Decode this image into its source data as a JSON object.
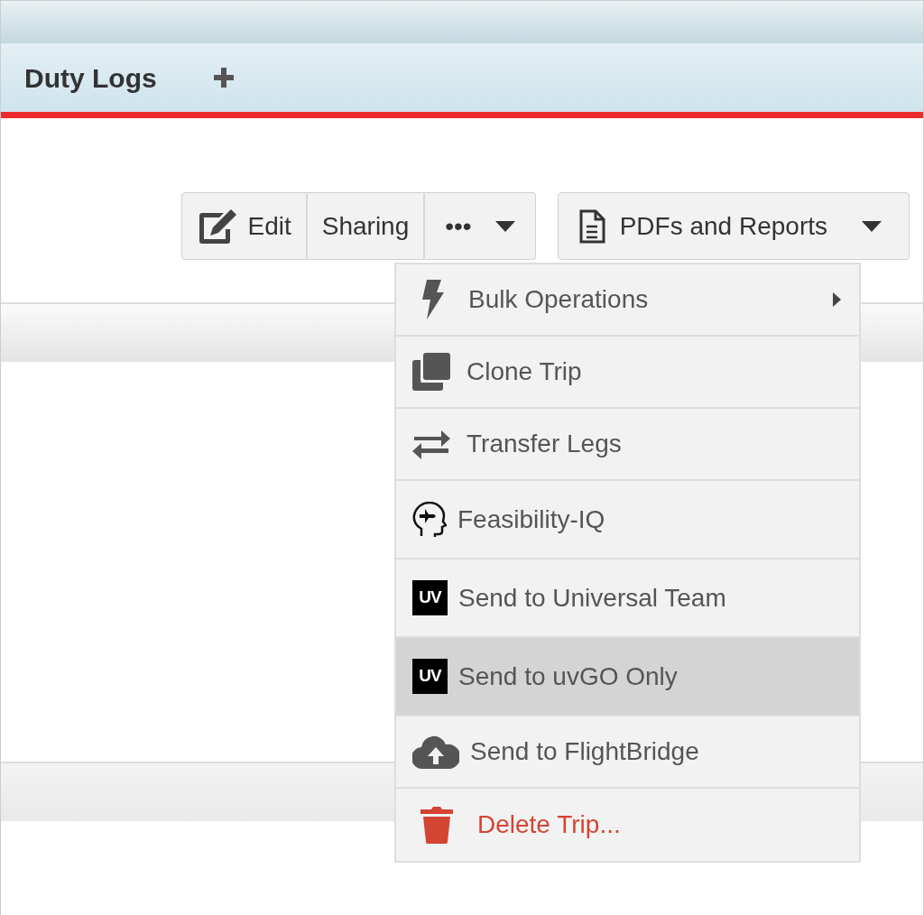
{
  "tab_bar": {
    "title": "Duty Logs"
  },
  "toolbar": {
    "buttons": [
      {
        "kind": "edit",
        "label": "Edit"
      },
      {
        "kind": "plain",
        "label": "Sharing"
      },
      {
        "kind": "more",
        "label": "•••",
        "expanded": true
      }
    ],
    "reports_button": {
      "label": "PDFs and Reports"
    }
  },
  "menu": {
    "items": [
      {
        "kind": "bolt",
        "label": "Bulk Operations",
        "submenu": true,
        "selected": false,
        "danger": false
      },
      {
        "kind": "copy",
        "label": "Clone Trip",
        "submenu": false,
        "selected": false,
        "danger": false
      },
      {
        "kind": "swap",
        "label": "Transfer Legs",
        "submenu": false,
        "selected": false,
        "danger": false
      },
      {
        "kind": "head",
        "label": "Feasibility-IQ",
        "submenu": false,
        "selected": false,
        "danger": false
      },
      {
        "kind": "badge",
        "badge": "UV",
        "label": "Send to Universal Team",
        "submenu": false,
        "selected": false,
        "danger": false
      },
      {
        "kind": "badge",
        "badge": "UV",
        "label": "Send to uvGO Only",
        "submenu": false,
        "selected": true,
        "danger": false
      },
      {
        "kind": "cloud",
        "label": "Send to FlightBridge",
        "submenu": false,
        "selected": false,
        "danger": false
      },
      {
        "kind": "trash",
        "label": "Delete Trip...",
        "submenu": false,
        "selected": false,
        "danger": true
      }
    ]
  }
}
